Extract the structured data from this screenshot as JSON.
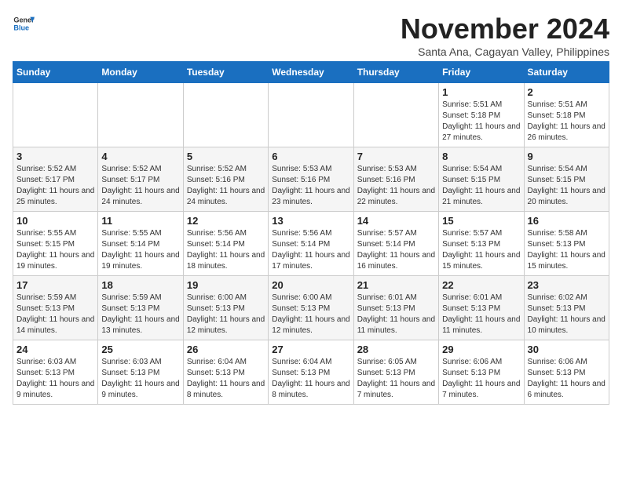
{
  "logo": {
    "line1": "General",
    "line2": "Blue"
  },
  "title": "November 2024",
  "subtitle": "Santa Ana, Cagayan Valley, Philippines",
  "days_header": [
    "Sunday",
    "Monday",
    "Tuesday",
    "Wednesday",
    "Thursday",
    "Friday",
    "Saturday"
  ],
  "weeks": [
    [
      {
        "day": "",
        "info": ""
      },
      {
        "day": "",
        "info": ""
      },
      {
        "day": "",
        "info": ""
      },
      {
        "day": "",
        "info": ""
      },
      {
        "day": "",
        "info": ""
      },
      {
        "day": "1",
        "info": "Sunrise: 5:51 AM\nSunset: 5:18 PM\nDaylight: 11 hours and 27 minutes."
      },
      {
        "day": "2",
        "info": "Sunrise: 5:51 AM\nSunset: 5:18 PM\nDaylight: 11 hours and 26 minutes."
      }
    ],
    [
      {
        "day": "3",
        "info": "Sunrise: 5:52 AM\nSunset: 5:17 PM\nDaylight: 11 hours and 25 minutes."
      },
      {
        "day": "4",
        "info": "Sunrise: 5:52 AM\nSunset: 5:17 PM\nDaylight: 11 hours and 24 minutes."
      },
      {
        "day": "5",
        "info": "Sunrise: 5:52 AM\nSunset: 5:16 PM\nDaylight: 11 hours and 24 minutes."
      },
      {
        "day": "6",
        "info": "Sunrise: 5:53 AM\nSunset: 5:16 PM\nDaylight: 11 hours and 23 minutes."
      },
      {
        "day": "7",
        "info": "Sunrise: 5:53 AM\nSunset: 5:16 PM\nDaylight: 11 hours and 22 minutes."
      },
      {
        "day": "8",
        "info": "Sunrise: 5:54 AM\nSunset: 5:15 PM\nDaylight: 11 hours and 21 minutes."
      },
      {
        "day": "9",
        "info": "Sunrise: 5:54 AM\nSunset: 5:15 PM\nDaylight: 11 hours and 20 minutes."
      }
    ],
    [
      {
        "day": "10",
        "info": "Sunrise: 5:55 AM\nSunset: 5:15 PM\nDaylight: 11 hours and 19 minutes."
      },
      {
        "day": "11",
        "info": "Sunrise: 5:55 AM\nSunset: 5:14 PM\nDaylight: 11 hours and 19 minutes."
      },
      {
        "day": "12",
        "info": "Sunrise: 5:56 AM\nSunset: 5:14 PM\nDaylight: 11 hours and 18 minutes."
      },
      {
        "day": "13",
        "info": "Sunrise: 5:56 AM\nSunset: 5:14 PM\nDaylight: 11 hours and 17 minutes."
      },
      {
        "day": "14",
        "info": "Sunrise: 5:57 AM\nSunset: 5:14 PM\nDaylight: 11 hours and 16 minutes."
      },
      {
        "day": "15",
        "info": "Sunrise: 5:57 AM\nSunset: 5:13 PM\nDaylight: 11 hours and 15 minutes."
      },
      {
        "day": "16",
        "info": "Sunrise: 5:58 AM\nSunset: 5:13 PM\nDaylight: 11 hours and 15 minutes."
      }
    ],
    [
      {
        "day": "17",
        "info": "Sunrise: 5:59 AM\nSunset: 5:13 PM\nDaylight: 11 hours and 14 minutes."
      },
      {
        "day": "18",
        "info": "Sunrise: 5:59 AM\nSunset: 5:13 PM\nDaylight: 11 hours and 13 minutes."
      },
      {
        "day": "19",
        "info": "Sunrise: 6:00 AM\nSunset: 5:13 PM\nDaylight: 11 hours and 12 minutes."
      },
      {
        "day": "20",
        "info": "Sunrise: 6:00 AM\nSunset: 5:13 PM\nDaylight: 11 hours and 12 minutes."
      },
      {
        "day": "21",
        "info": "Sunrise: 6:01 AM\nSunset: 5:13 PM\nDaylight: 11 hours and 11 minutes."
      },
      {
        "day": "22",
        "info": "Sunrise: 6:01 AM\nSunset: 5:13 PM\nDaylight: 11 hours and 11 minutes."
      },
      {
        "day": "23",
        "info": "Sunrise: 6:02 AM\nSunset: 5:13 PM\nDaylight: 11 hours and 10 minutes."
      }
    ],
    [
      {
        "day": "24",
        "info": "Sunrise: 6:03 AM\nSunset: 5:13 PM\nDaylight: 11 hours and 9 minutes."
      },
      {
        "day": "25",
        "info": "Sunrise: 6:03 AM\nSunset: 5:13 PM\nDaylight: 11 hours and 9 minutes."
      },
      {
        "day": "26",
        "info": "Sunrise: 6:04 AM\nSunset: 5:13 PM\nDaylight: 11 hours and 8 minutes."
      },
      {
        "day": "27",
        "info": "Sunrise: 6:04 AM\nSunset: 5:13 PM\nDaylight: 11 hours and 8 minutes."
      },
      {
        "day": "28",
        "info": "Sunrise: 6:05 AM\nSunset: 5:13 PM\nDaylight: 11 hours and 7 minutes."
      },
      {
        "day": "29",
        "info": "Sunrise: 6:06 AM\nSunset: 5:13 PM\nDaylight: 11 hours and 7 minutes."
      },
      {
        "day": "30",
        "info": "Sunrise: 6:06 AM\nSunset: 5:13 PM\nDaylight: 11 hours and 6 minutes."
      }
    ]
  ]
}
